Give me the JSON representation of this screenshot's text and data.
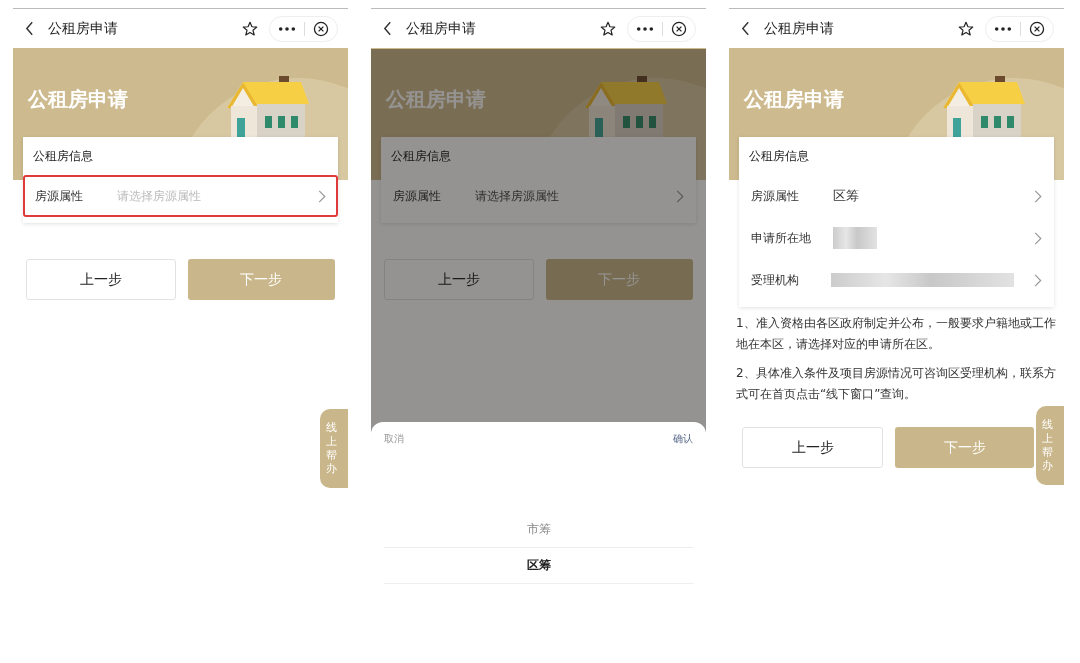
{
  "screens": [
    {
      "nav_title": "公租房申请",
      "banner_title": "公租房申请",
      "card": {
        "heading": "公租房信息",
        "rows": [
          {
            "label": "房源属性",
            "kind": "select",
            "placeholder": "请选择房源属性",
            "highlighted": true
          }
        ]
      },
      "buttons": [
        {
          "label": "上一步",
          "kind": "secondary"
        },
        {
          "label": "下一步",
          "kind": "primary"
        }
      ],
      "help_tab": "线上帮办"
    },
    {
      "nav_title": "公租房申请",
      "banner_title": "公租房申请",
      "dimmed": true,
      "card": {
        "heading": "公租房信息",
        "rows": [
          {
            "label": "房源属性",
            "kind": "select",
            "placeholder": "请选择房源属性",
            "highlighted": false
          }
        ]
      },
      "buttons": [
        {
          "label": "上一步",
          "kind": "secondary"
        },
        {
          "label": "下一步",
          "kind": "primary"
        }
      ],
      "picker": {
        "cancel": "取消",
        "confirm": "确认",
        "options": [
          {
            "label": "市筹",
            "selected": false
          },
          {
            "label": "区筹",
            "selected": true
          }
        ]
      }
    },
    {
      "nav_title": "公租房申请",
      "banner_title": "公租房申请",
      "card": {
        "heading": "公租房信息",
        "rows": [
          {
            "label": "房源属性",
            "kind": "value",
            "value": "区筹",
            "highlighted": false
          },
          {
            "label": "申请所在地",
            "kind": "short-blur",
            "highlighted": false
          },
          {
            "label": "受理机构",
            "kind": "long-blur",
            "highlighted": false
          }
        ]
      },
      "notes": [
        "1、准入资格由各区政府制定并公布，一般要求户籍地或工作地在本区，请选择对应的申请所在区。",
        "2、具体准入条件及项目房源情况可咨询区受理机构，联系方式可在首页点击“线下窗口”查询。"
      ],
      "buttons": [
        {
          "label": "上一步",
          "kind": "secondary"
        },
        {
          "label": "下一步",
          "kind": "primary"
        }
      ],
      "help_tab": "线上帮办"
    }
  ]
}
